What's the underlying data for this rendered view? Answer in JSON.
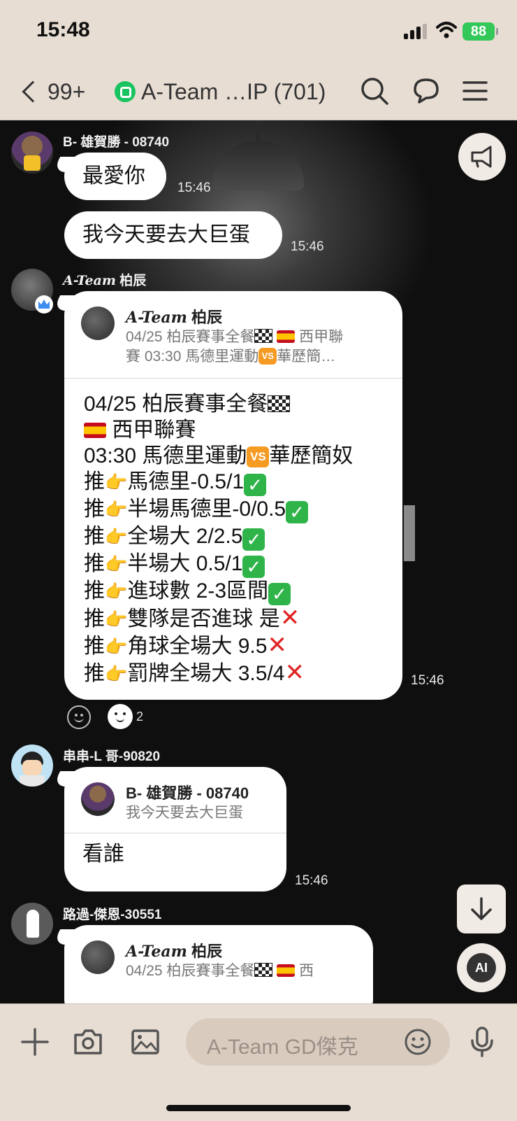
{
  "status": {
    "time": "15:48",
    "battery": "88"
  },
  "header": {
    "back_count": "99+",
    "title": "A-Team …IP (701)"
  },
  "messages": {
    "m1": {
      "sender": "B- 雄賀勝 - 08740",
      "text": "最愛你",
      "time": "15:46"
    },
    "m2": {
      "text": "我今天要去大巨蛋",
      "time": "15:46"
    },
    "m3": {
      "sender_serif": "A-Team",
      "sender_rest": " 柏辰",
      "reply_name_serif": "A-Team",
      "reply_name_rest": " 柏辰",
      "reply_snip_1": "04/25 柏辰賽事全餐",
      "reply_snip_1b": "西甲聯",
      "reply_snip_2": "賽 03:30 馬德里運動",
      "reply_snip_2b": "華歷簡…",
      "vs": "VS",
      "lines": [
        "04/25 柏辰賽事全餐",
        "西甲聯賽",
        "03:30 馬德里運動",
        "華歷簡奴",
        "推",
        "馬德里-0.5/1",
        "半場馬德里-0/0.5",
        "全場大 2/2.5",
        "半場大 0.5/1",
        "進球數 2-3區間",
        "雙隊是否進球 是",
        "角球全場大 9.5",
        "罰牌全場大 3.5/4"
      ],
      "time": "15:46",
      "reaction_count": "2"
    },
    "m4": {
      "sender": "串串-L 哥-90820",
      "reply_name": "B- 雄賀勝 - 08740",
      "reply_snip": "我今天要去大巨蛋",
      "text": "看誰",
      "time": "15:46"
    },
    "m5": {
      "sender": "路過-傑恩-30551",
      "reply_name_serif": "A-Team",
      "reply_name_rest": " 柏辰",
      "reply_snip": "04/25 柏辰賽事全餐",
      "reply_snip_b": "西"
    }
  },
  "fab": {
    "ai_label": "AI"
  },
  "input": {
    "placeholder": "A-Team GD傑克"
  },
  "colors": {
    "header_bg": "#e8ddd3",
    "bubble": "#ffffff",
    "line_green": "#19c35f",
    "check_green": "#2fb44a",
    "cross_red": "#e02424"
  }
}
